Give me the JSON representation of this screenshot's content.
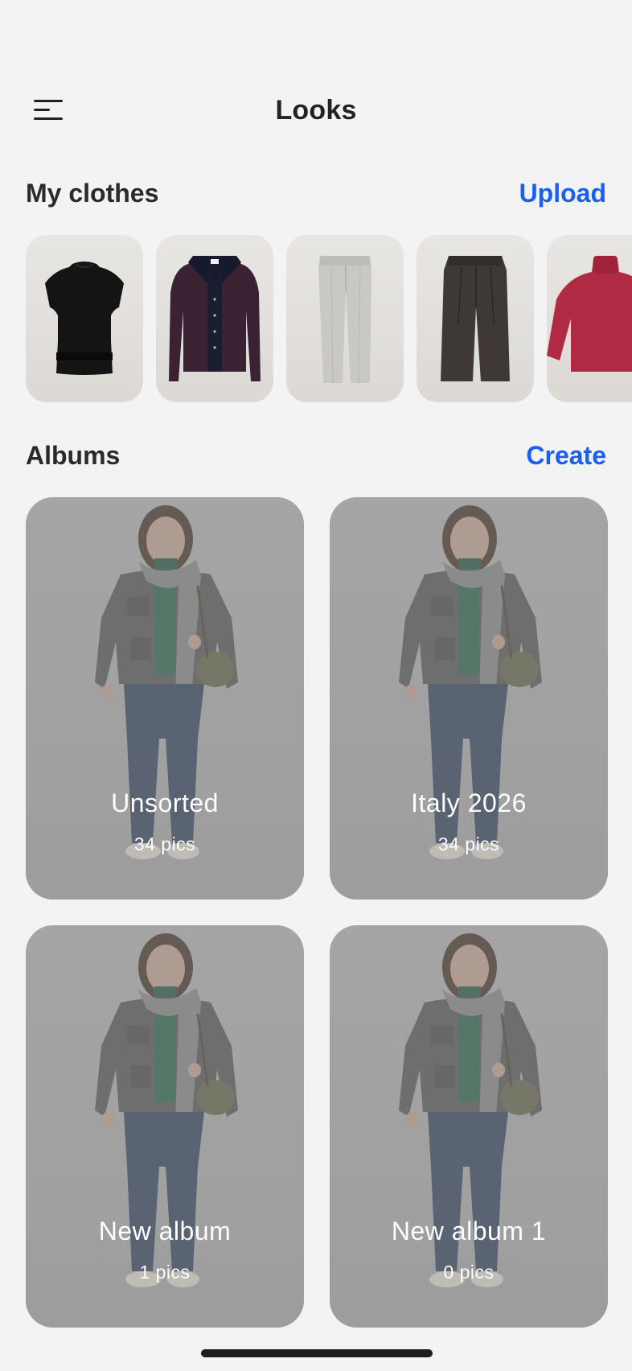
{
  "header": {
    "title": "Looks",
    "menu_icon": "hamburger-menu-icon"
  },
  "clothes": {
    "title": "My clothes",
    "action_label": "Upload",
    "items": [
      {
        "name": "black-sleeveless-top",
        "color": "#141414"
      },
      {
        "name": "navy-burgundy-cardigan",
        "color": "#3a2232"
      },
      {
        "name": "light-grey-trousers",
        "color": "#c9c8c4"
      },
      {
        "name": "dark-brown-trousers",
        "color": "#3f3936"
      },
      {
        "name": "red-turtleneck-sweater",
        "color": "#b02a44"
      }
    ]
  },
  "albums": {
    "title": "Albums",
    "action_label": "Create",
    "items": [
      {
        "name": "Unsorted",
        "count": "34 pics"
      },
      {
        "name": "Italy 2026",
        "count": "34 pics"
      },
      {
        "name": "New album",
        "count": "1 pics"
      },
      {
        "name": "New album 1",
        "count": "0 pics"
      }
    ]
  },
  "colors": {
    "accent": "#1a5ff0",
    "background": "#f3f3f3"
  }
}
